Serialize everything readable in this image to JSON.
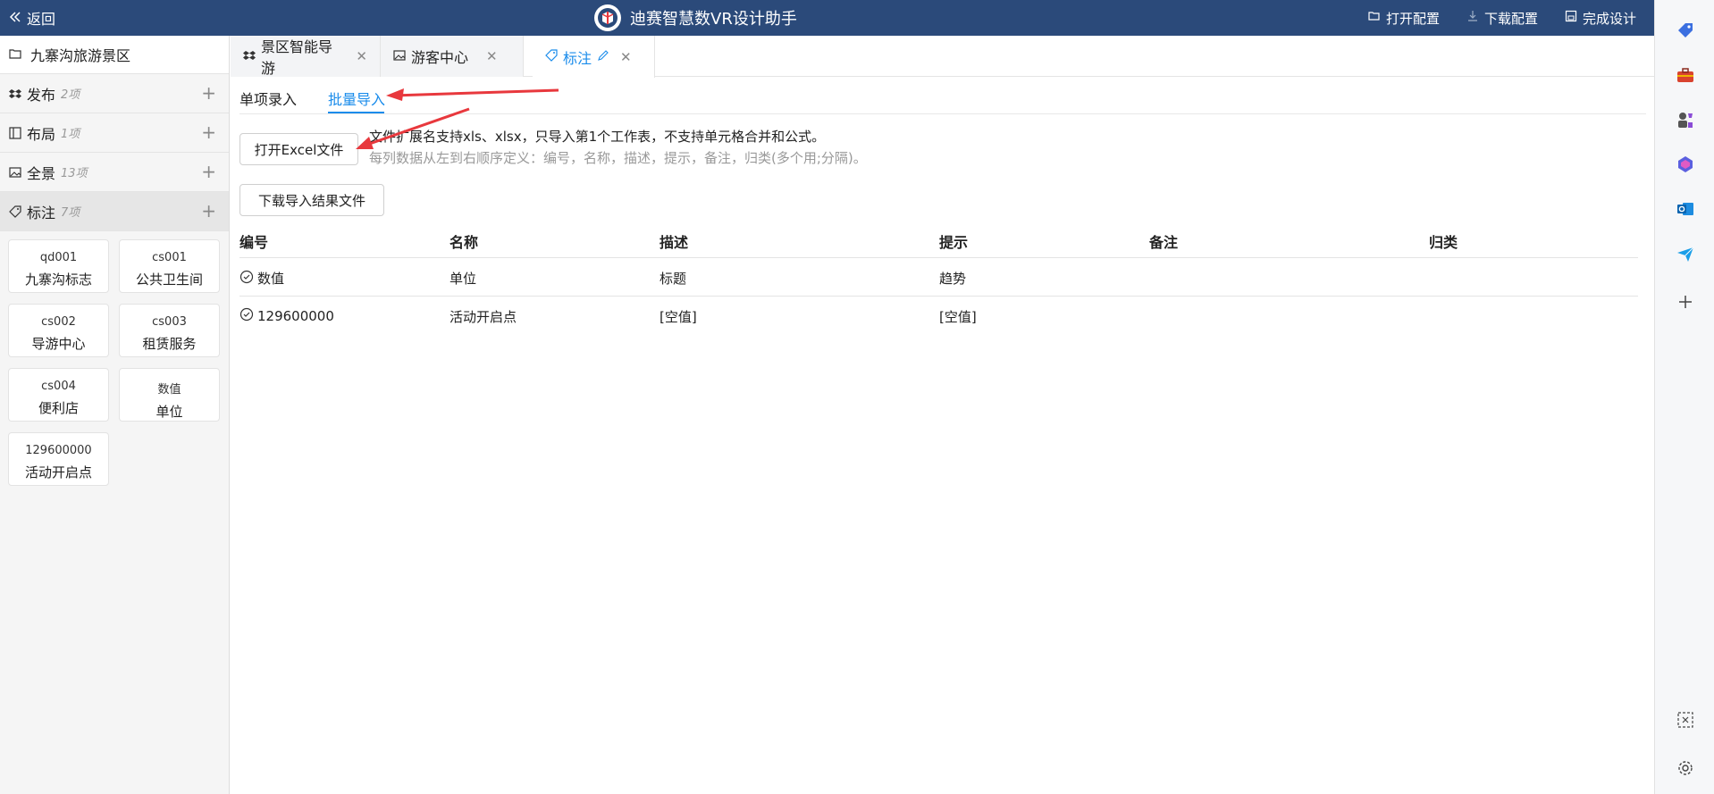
{
  "topbar": {
    "back_label": "返回",
    "title": "迪赛智慧数VR设计助手",
    "actions": [
      {
        "label": "打开配置",
        "icon": "folder-open-icon"
      },
      {
        "label": "下载配置",
        "icon": "download-icon"
      },
      {
        "label": "完成设计",
        "icon": "save-icon"
      }
    ]
  },
  "sidebar": {
    "project": "九寨沟旅游景区",
    "groups": [
      {
        "label": "发布",
        "count": "2项",
        "icon": "dropbox-icon"
      },
      {
        "label": "布局",
        "count": "1项",
        "icon": "layout-icon"
      },
      {
        "label": "全景",
        "count": "13项",
        "icon": "image-icon"
      },
      {
        "label": "标注",
        "count": "7项",
        "icon": "tag-icon"
      }
    ],
    "cards": [
      {
        "code": "qd001",
        "name": "九寨沟标志"
      },
      {
        "code": "cs001",
        "name": "公共卫生间"
      },
      {
        "code": "cs002",
        "name": "导游中心"
      },
      {
        "code": "cs003",
        "name": "租赁服务"
      },
      {
        "code": "cs004",
        "name": "便利店"
      },
      {
        "code": "数值",
        "name": "单位"
      },
      {
        "code": "129600000",
        "name": "活动开启点"
      }
    ]
  },
  "tabs": [
    {
      "label": "景区智能导游",
      "icon": "dropbox-icon"
    },
    {
      "label": "游客中心",
      "icon": "image-icon"
    },
    {
      "label": "标注",
      "icon": "tag-icon"
    }
  ],
  "subtabs": {
    "single": "单项录入",
    "batch": "批量导入"
  },
  "buttons": {
    "open_excel": "打开Excel文件",
    "download_result": "下载导入结果文件"
  },
  "hints": {
    "line1": "文件扩展名支持xls、xlsx，只导入第1个工作表，不支持单元格合并和公式。",
    "line2": "每列数据从左到右顺序定义：编号，名称，描述，提示，备注，归类(多个用;分隔)。"
  },
  "table": {
    "headers": [
      "编号",
      "名称",
      "描述",
      "提示",
      "备注",
      "归类"
    ],
    "rows": [
      [
        "数值",
        "单位",
        "标题",
        "趋势",
        "",
        ""
      ],
      [
        "129600000",
        "活动开启点",
        "[空值]",
        "[空值]",
        "",
        ""
      ]
    ]
  },
  "colors": {
    "topbar": "#2b4a7a",
    "accent": "#1a8ceb",
    "arrow": "#e8383d"
  }
}
